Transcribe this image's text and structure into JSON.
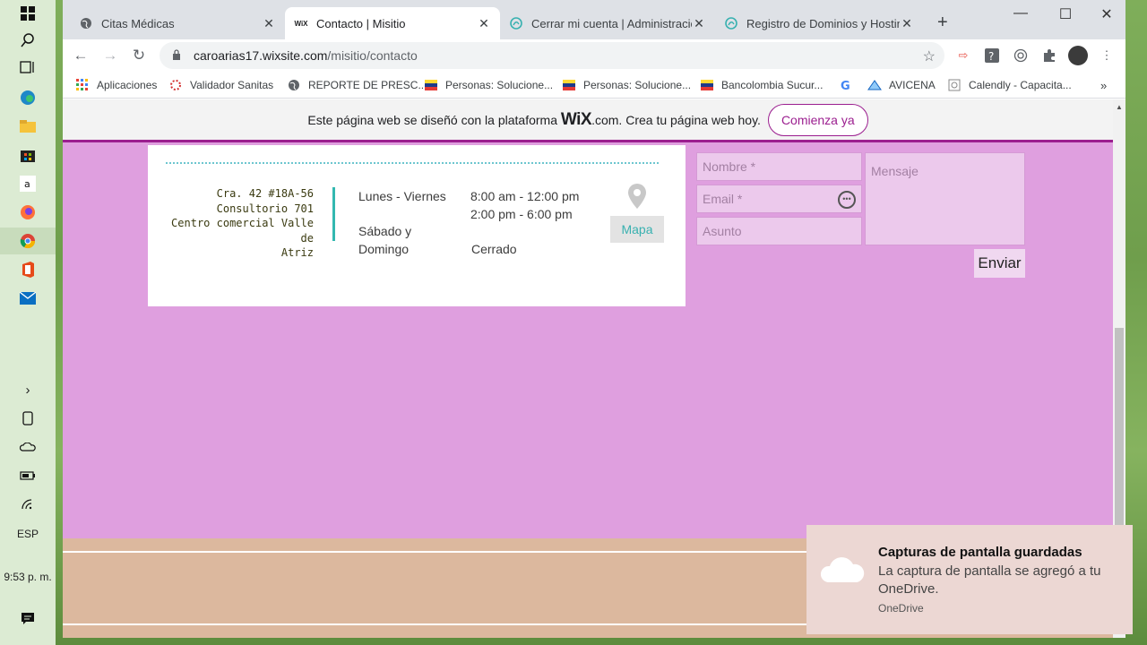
{
  "taskbar": {
    "language": "ESP",
    "clock": "9:53 p. m."
  },
  "tabs": [
    {
      "title": "Citas Médicas",
      "favicon": "globe-icon"
    },
    {
      "title": "Contacto | Misitio",
      "favicon": "wix-icon",
      "active": true,
      "favicon_text": "WiX"
    },
    {
      "title": "Cerrar mi cuenta | Administración",
      "favicon": "hostinger-icon"
    },
    {
      "title": "Registro de Dominios y Hosting en",
      "favicon": "hostinger-icon"
    }
  ],
  "toolbar": {
    "url_host": "caroarias17.wixsite.com",
    "url_path": "/misitio/contacto"
  },
  "bookmarks": [
    {
      "label": "Aplicaciones",
      "icon": "apps-grid-icon"
    },
    {
      "label": "Validador Sanitas",
      "icon": "sanitas-icon"
    },
    {
      "label": "REPORTE DE PRESC...",
      "icon": "globe-icon"
    },
    {
      "label": "Personas: Solucione...",
      "icon": "bancolombia-icon"
    },
    {
      "label": "Personas: Solucione...",
      "icon": "bancolombia-icon"
    },
    {
      "label": "Bancolombia Sucur...",
      "icon": "bancolombia-icon"
    },
    {
      "label": "",
      "icon": "google-icon"
    },
    {
      "label": "AVICENA",
      "icon": "avicena-icon"
    },
    {
      "label": "Calendly - Capacita...",
      "icon": "calendly-icon"
    }
  ],
  "wix_banner": {
    "text_before": "Este página web se diseñó con la plataforma",
    "logo": "WiX",
    "text_after": ".com. Crea tu página web hoy.",
    "cta": "Comienza ya"
  },
  "contact": {
    "address": [
      "Cra. 42 #18A-56",
      "Consultorio 701",
      "Centro comercial Valle de",
      "Atriz"
    ],
    "hours": [
      {
        "days": "Lunes -  Viernes",
        "times": [
          "8:00 am - 12:00 pm",
          "2:00 pm - 6:00 pm"
        ]
      },
      {
        "days_line1": "Sábado y",
        "days_line2": "Domingo",
        "times": [
          "Cerrado"
        ]
      }
    ],
    "map_button": "Mapa"
  },
  "form": {
    "name_placeholder": "Nombre *",
    "email_placeholder": "Email *",
    "subject_placeholder": "Asunto",
    "message_placeholder": "Mensaje",
    "submit": "Enviar"
  },
  "toast": {
    "title": "Capturas de pantalla guardadas",
    "body": "La captura de pantalla se agregó a tu OneDrive.",
    "source": "OneDrive"
  },
  "colors": {
    "page_background": "#df9fdf",
    "wix_accent": "#9b1e8f",
    "teal_accent": "#33b8b0",
    "footer": "#dcb89e"
  }
}
